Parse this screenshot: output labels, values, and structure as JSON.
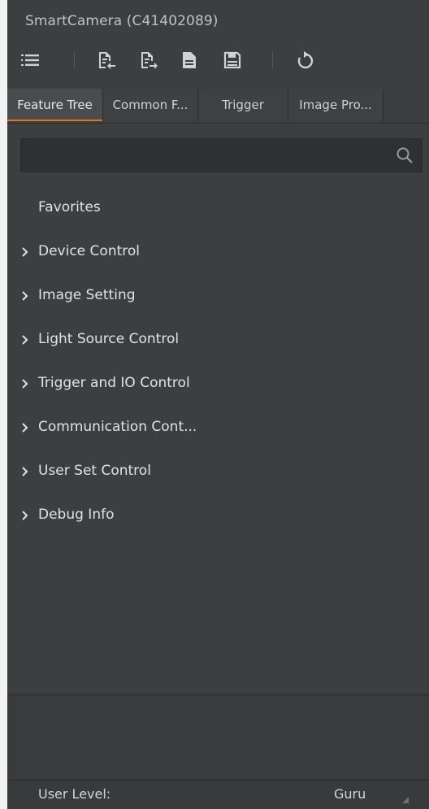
{
  "window": {
    "title": "SmartCamera (C41402089)"
  },
  "toolbar": {
    "icons": [
      "tree-view-icon",
      "import-icon",
      "export-icon",
      "document-icon",
      "save-icon",
      "refresh-icon"
    ]
  },
  "tabs": [
    {
      "label": "Feature Tree",
      "active": true
    },
    {
      "label": "Common F..."
    },
    {
      "label": "Trigger"
    },
    {
      "label": "Image Pro..."
    }
  ],
  "search": {
    "value": "",
    "placeholder": ""
  },
  "tree": {
    "items": [
      {
        "label": "Favorites",
        "expandable": false
      },
      {
        "label": "Device Control",
        "expandable": true
      },
      {
        "label": "Image Setting",
        "expandable": true
      },
      {
        "label": "Light Source Control",
        "expandable": true
      },
      {
        "label": "Trigger and IO Control",
        "expandable": true
      },
      {
        "label": "Communication Cont...",
        "expandable": true
      },
      {
        "label": "User Set Control",
        "expandable": true
      },
      {
        "label": "Debug Info",
        "expandable": true
      }
    ]
  },
  "status": {
    "user_level_label": "User Level:",
    "user_level_value": "Guru"
  },
  "colors": {
    "accent": "#e0741f",
    "background": "#3d3e40"
  }
}
